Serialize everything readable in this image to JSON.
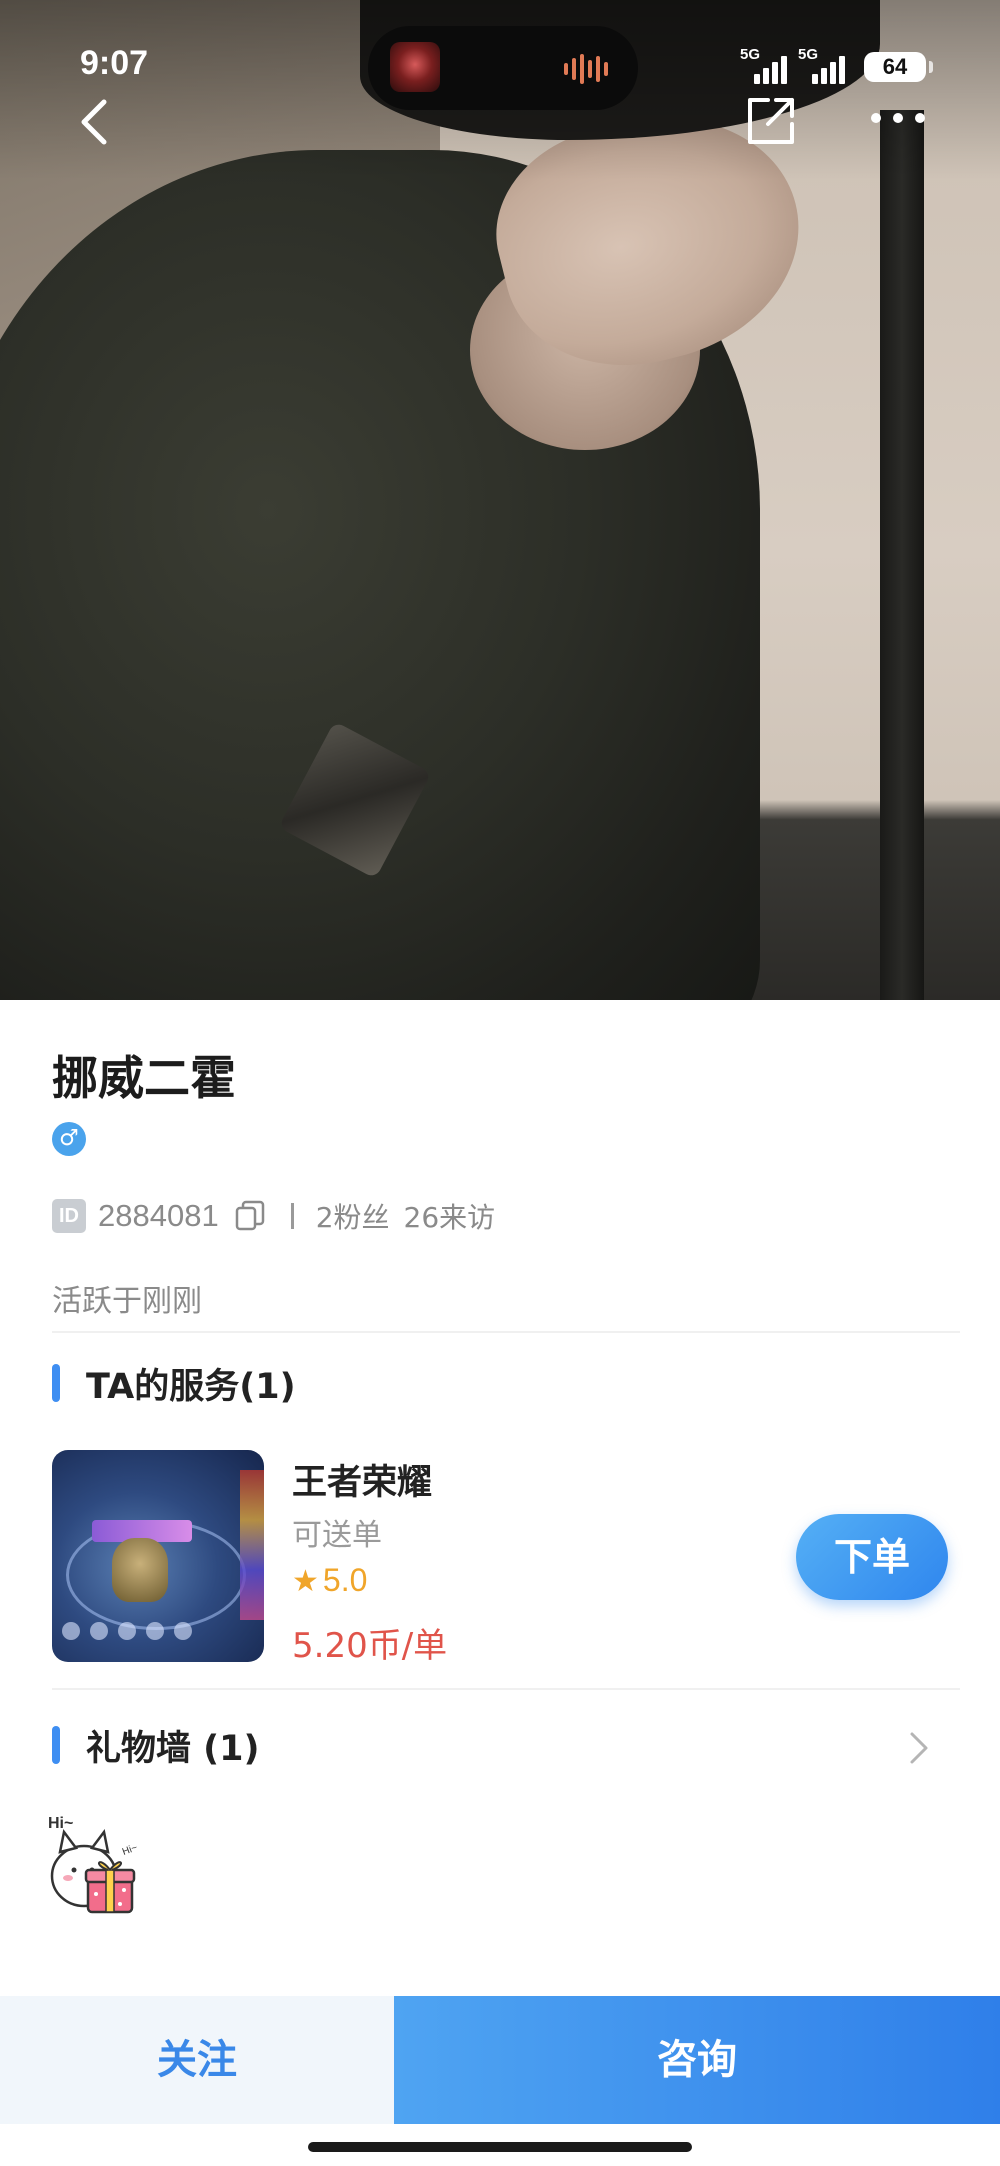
{
  "status_bar": {
    "time": "9:07",
    "signal1": "5G",
    "signal2": "5G",
    "battery": "64"
  },
  "profile": {
    "name": "挪威二霍",
    "gender_symbol": "♂",
    "id_tag": "ID",
    "id_number": "2884081",
    "fans": "2粉丝",
    "visits": "26来访",
    "active_status": "活跃于刚刚"
  },
  "services": {
    "section_title": "TA的服务(1)",
    "items": [
      {
        "name": "王者荣耀",
        "subtitle": "可送单",
        "rating": "5.0",
        "price": "5.20币/单",
        "order_label": "下单"
      }
    ]
  },
  "gifts": {
    "section_title": "礼物墙 (1)",
    "gift_text": "Hi~"
  },
  "bottom_bar": {
    "follow_label": "关注",
    "consult_label": "咨询"
  },
  "colors": {
    "accent": "#3e8ef2",
    "price": "#e0544a",
    "star": "#f0a52a"
  }
}
